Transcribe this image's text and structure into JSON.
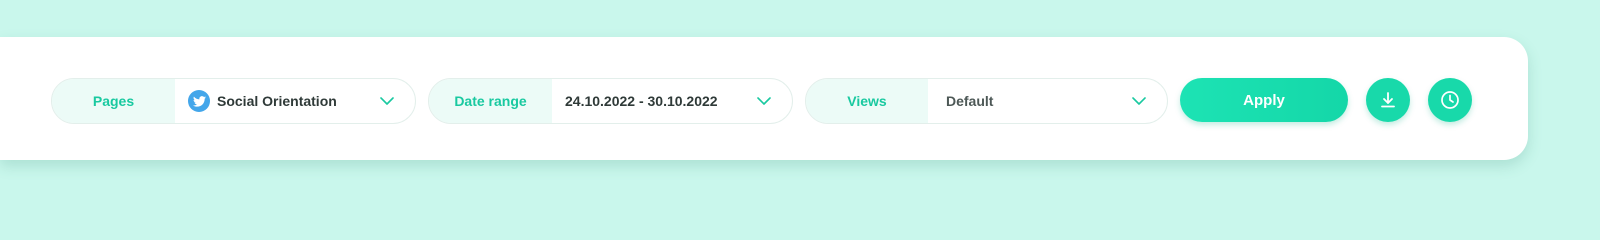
{
  "filters": {
    "pages": {
      "label": "Pages",
      "value": "Social Orientation",
      "icon": "twitter-icon"
    },
    "date_range": {
      "label": "Date range",
      "value": "24.10.2022 - 30.10.2022"
    },
    "views": {
      "label": "Views",
      "value": "Default"
    }
  },
  "actions": {
    "apply_label": "Apply",
    "download_icon": "download-icon",
    "history_icon": "clock-icon"
  },
  "colors": {
    "page_bg": "#c9f7ec",
    "accent": "#18d9aa",
    "label_text": "#19c9a0",
    "label_bg": "#ecfbf7",
    "twitter": "#43a6ea"
  }
}
